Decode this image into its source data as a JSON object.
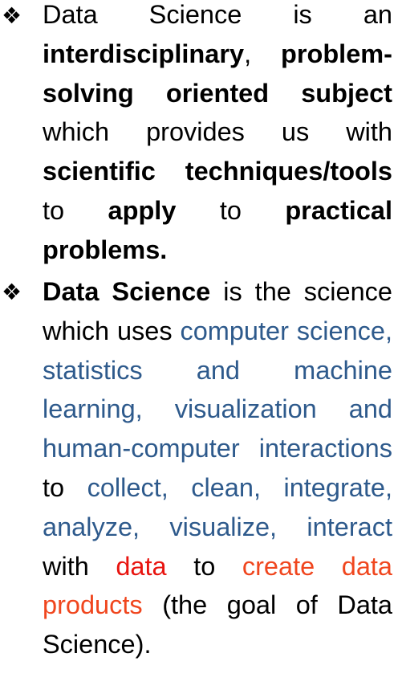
{
  "bullet1": {
    "icon": "diamond-fleuron-icon",
    "p1": "Data Science is an",
    "b1": "interdisciplinary",
    "p2": ",",
    "b2": "problem-solving oriented subject",
    "p3": "which provides us with",
    "b3": "scientific techniques/tools",
    "p4": "to",
    "b4": "apply",
    "p5": "to",
    "b5": "practical problems."
  },
  "bullet2": {
    "icon": "diamond-fleuron-icon",
    "b1": "Data Science",
    "p1": "is the science which uses",
    "blue1": "computer science, statistics and machine learning, visualization and human-computer interactions",
    "p2": "to",
    "blue2": "collect, clean, integrate, analyze, visualize, interact",
    "p3": "with",
    "red1": "data",
    "p4": "to",
    "orange1": "create data products",
    "p5": "(the goal of Data Science)."
  },
  "colors": {
    "text": "#000000",
    "blue_emphasis": "#2E5A8C",
    "red_emphasis": "#E8140F",
    "orange_emphasis": "#F0461E"
  }
}
